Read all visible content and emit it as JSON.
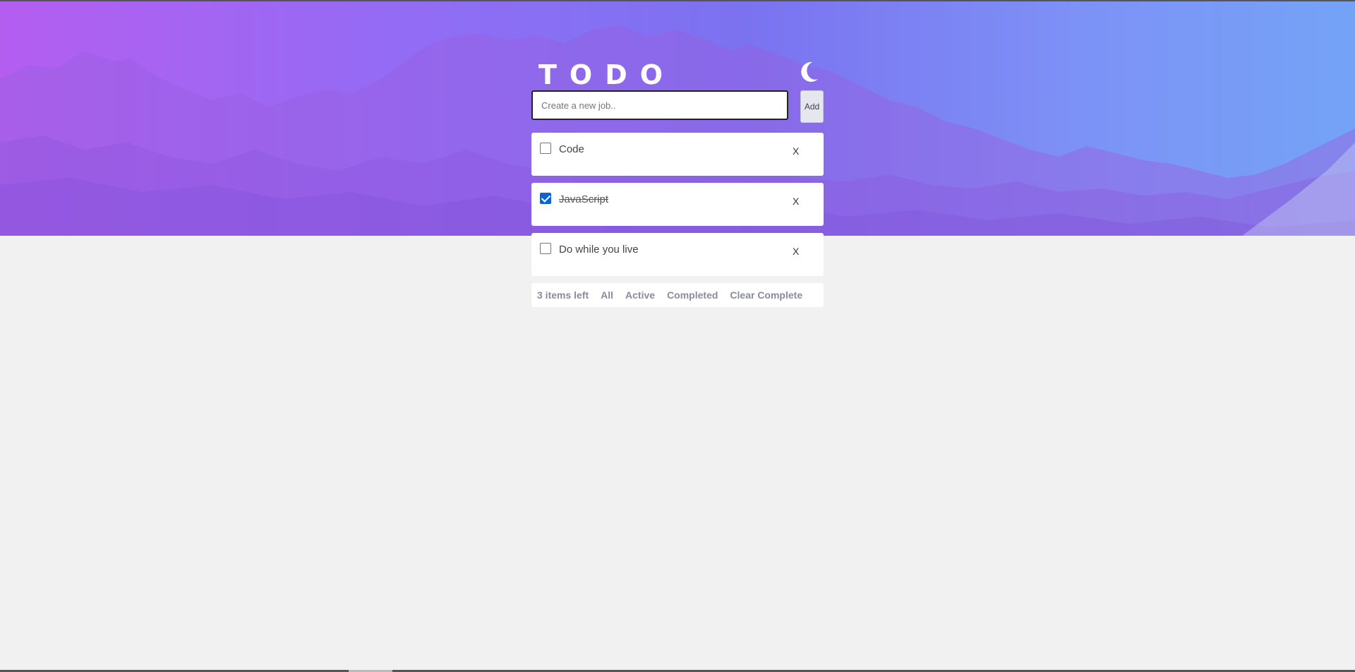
{
  "app": {
    "title": "TODO",
    "theme_toggle_icon": "moon-icon"
  },
  "new_job": {
    "placeholder": "Create a new job..",
    "value": "",
    "add_label": "Add"
  },
  "todos": [
    {
      "text": "Code",
      "completed": false,
      "delete_label": "X"
    },
    {
      "text": "JavaScript",
      "completed": true,
      "delete_label": "X"
    },
    {
      "text": "Do while you live",
      "completed": false,
      "delete_label": "X"
    }
  ],
  "footer": {
    "items_left": "3 items left",
    "filter_all": "All",
    "filter_active": "Active",
    "filter_completed": "Completed",
    "clear_completed": "Clear Complete"
  },
  "colors": {
    "accent_checkbox": "#0a64d8",
    "hero_gradient_start": "#b45ef0",
    "hero_gradient_end": "#74a3f6",
    "page_background": "#f1f1f1"
  }
}
